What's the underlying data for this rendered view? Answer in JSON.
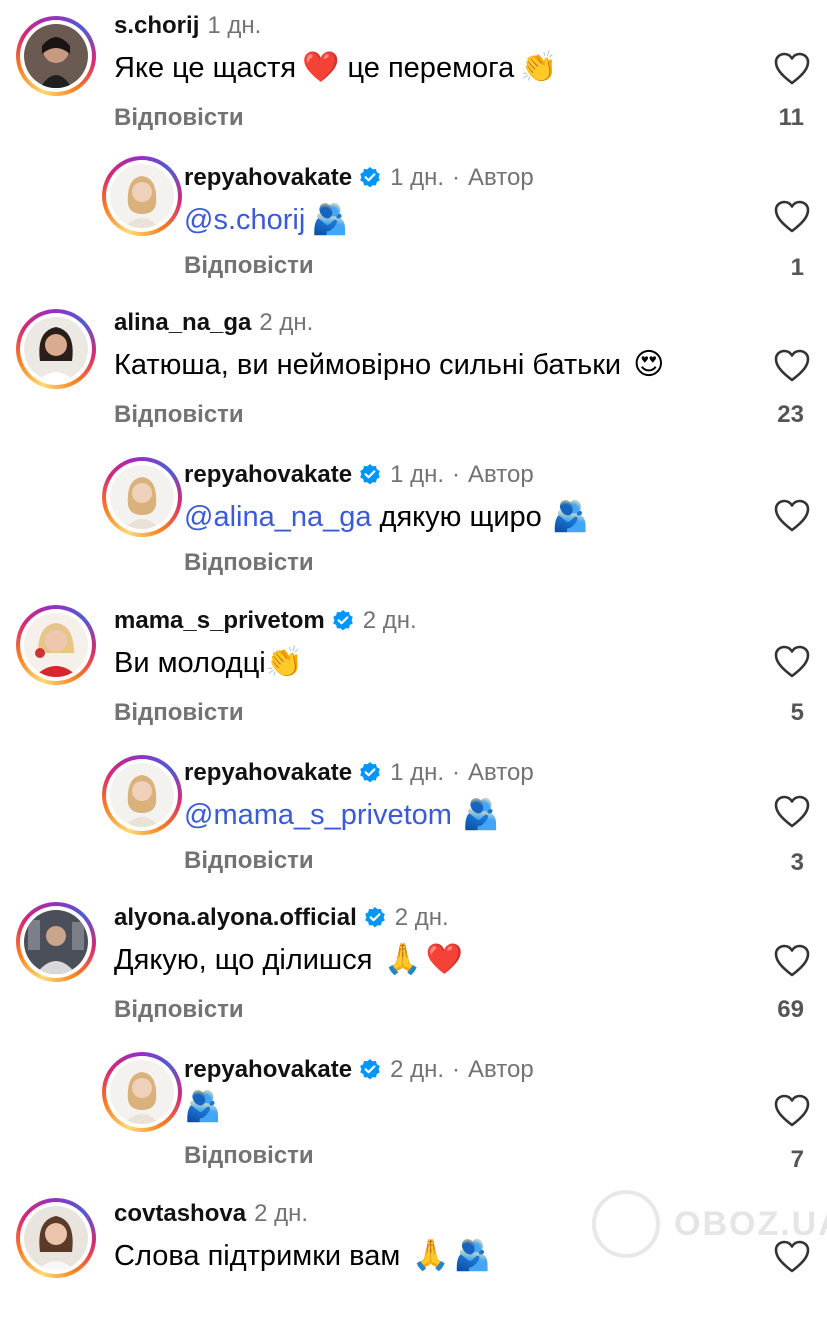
{
  "reply_label": "Відповісти",
  "author_label": "Автор",
  "watermark": "OBOZ.UA",
  "colors": {
    "mention": "#3b5bd6",
    "verified": "#0095f6",
    "meta": "#737373"
  },
  "comments": [
    {
      "user": "s.chorij",
      "time": "1 дн.",
      "verified": false,
      "author": false,
      "text": "Яке це щастя",
      "emoji1": "❤️",
      "text2": " це перемога",
      "emoji2": "👏",
      "likes": "11"
    },
    {
      "user": "repyahovakate",
      "time": "1 дн.",
      "verified": true,
      "author": true,
      "mention": "@s.chorij",
      "emoji1": "🫂",
      "likes": "1"
    },
    {
      "user": "alina_na_ga",
      "time": "2 дн.",
      "verified": false,
      "author": false,
      "text": "Катюша, ви неймовірно сильні батьки",
      "emoji1": "😍",
      "likes": "23"
    },
    {
      "user": "repyahovakate",
      "time": "1 дн.",
      "verified": true,
      "author": true,
      "mention": "@alina_na_ga",
      "text": " дякую щиро",
      "emoji1": "🫂",
      "likes": ""
    },
    {
      "user": "mama_s_privetom",
      "time": "2 дн.",
      "verified": true,
      "author": false,
      "text": "Ви молодці",
      "emoji1": "👏",
      "likes": "5"
    },
    {
      "user": "repyahovakate",
      "time": "1 дн.",
      "verified": true,
      "author": true,
      "mention": "@mama_s_privetom",
      "emoji1": "🫂",
      "likes": "3"
    },
    {
      "user": "alyona.alyona.official",
      "time": "2 дн.",
      "verified": true,
      "author": false,
      "text": "Дякую, що ділишся",
      "emoji1": "🙏",
      "emoji2": "❤️",
      "likes": "69"
    },
    {
      "user": "repyahovakate",
      "time": "2 дн.",
      "verified": true,
      "author": true,
      "emoji1": "🫂",
      "likes": "7"
    },
    {
      "user": "covtashova",
      "time": "2 дн.",
      "verified": false,
      "author": false,
      "text": "Слова підтримки вам",
      "emoji1": "🙏",
      "emoji2": "🫂",
      "likes": ""
    }
  ]
}
